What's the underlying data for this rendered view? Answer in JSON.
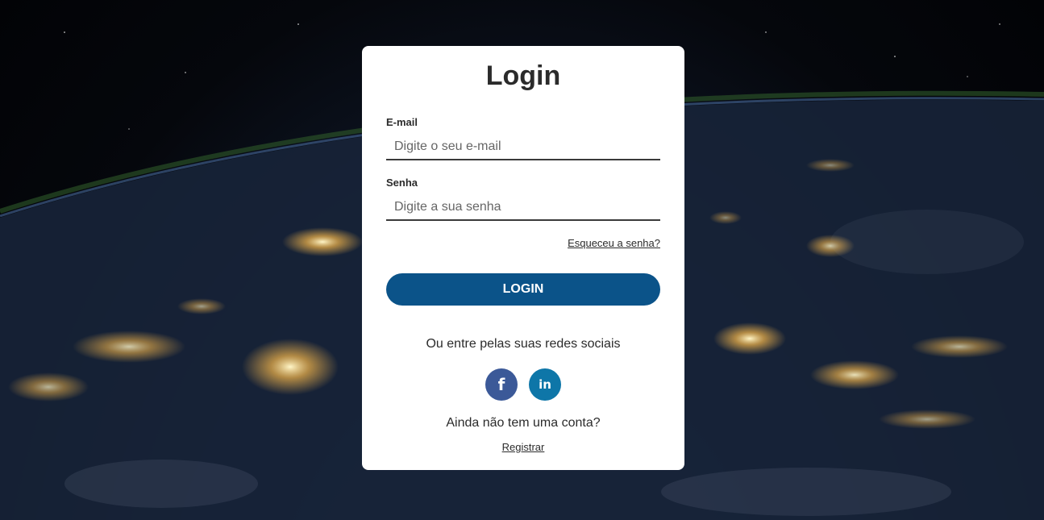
{
  "login": {
    "title": "Login",
    "email": {
      "label": "E-mail",
      "placeholder": "Digite o seu e-mail",
      "value": ""
    },
    "password": {
      "label": "Senha",
      "placeholder": "Digite a sua senha",
      "value": ""
    },
    "forgot_link": "Esqueceu a senha?",
    "submit_label": "LOGIN",
    "social_prompt": "Ou entre pelas suas redes sociais",
    "social": [
      {
        "icon": "facebook-icon",
        "glyph": "f",
        "color": "#3b5998"
      },
      {
        "icon": "linkedin-icon",
        "glyph": "in",
        "color": "#0e76a8"
      }
    ],
    "no_account_text": "Ainda não tem uma conta?",
    "register_link": "Registrar"
  },
  "colors": {
    "primary_button": "#0b5389",
    "card_background": "#ffffff",
    "text": "#2b2b2b"
  }
}
